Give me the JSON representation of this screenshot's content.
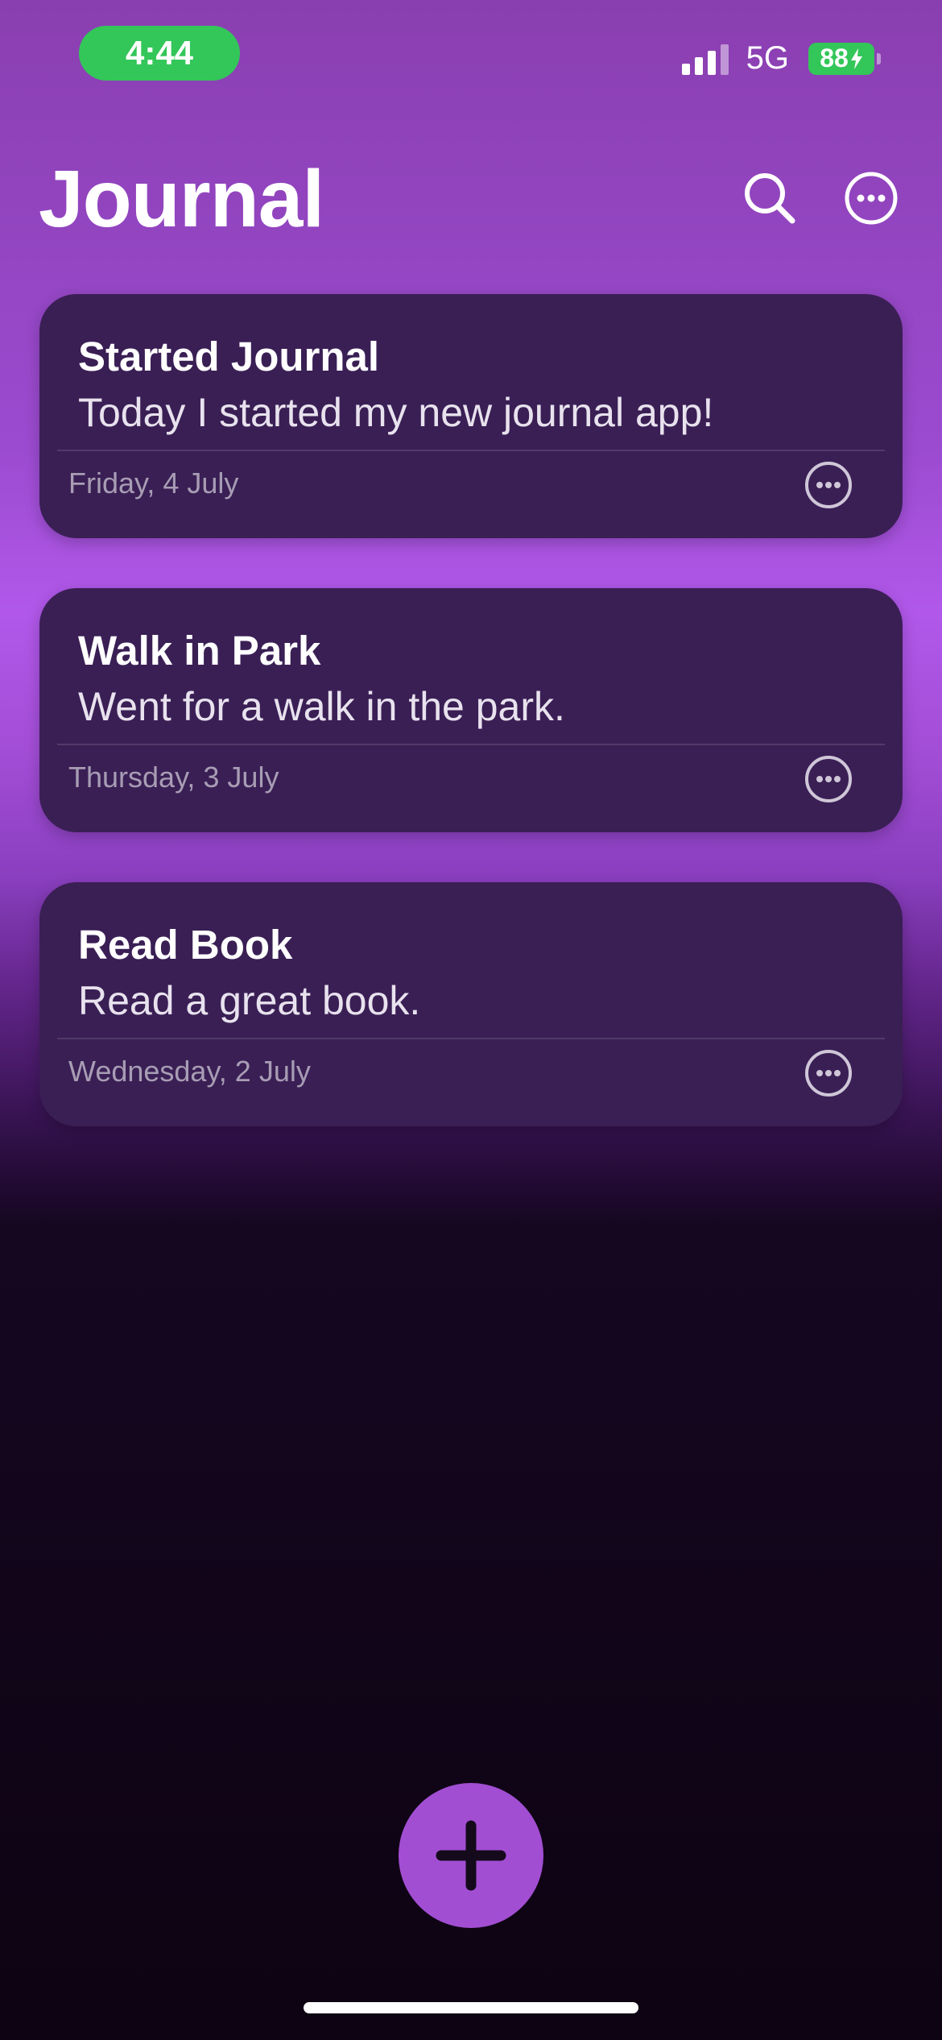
{
  "status_bar": {
    "time": "4:44",
    "network": "5G",
    "battery": "88",
    "time_pill_color": "#33c659"
  },
  "header": {
    "title": "Journal",
    "search_icon": "search-icon",
    "more_icon": "ellipsis-circle-icon"
  },
  "entries": [
    {
      "title": "Started Journal",
      "body": "Today I started my new journal app!",
      "date": "Friday, 4 July"
    },
    {
      "title": "Walk in Park",
      "body": "Went for a walk in the park.",
      "date": "Thursday, 3 July"
    },
    {
      "title": "Read Book",
      "body": "Read a great book.",
      "date": "Wednesday, 2 July"
    }
  ],
  "add_button": {
    "icon": "plus-icon",
    "color": "#a24ed3"
  },
  "theme": {
    "card_color": "#3a1f55",
    "accent": "#b158ea"
  }
}
